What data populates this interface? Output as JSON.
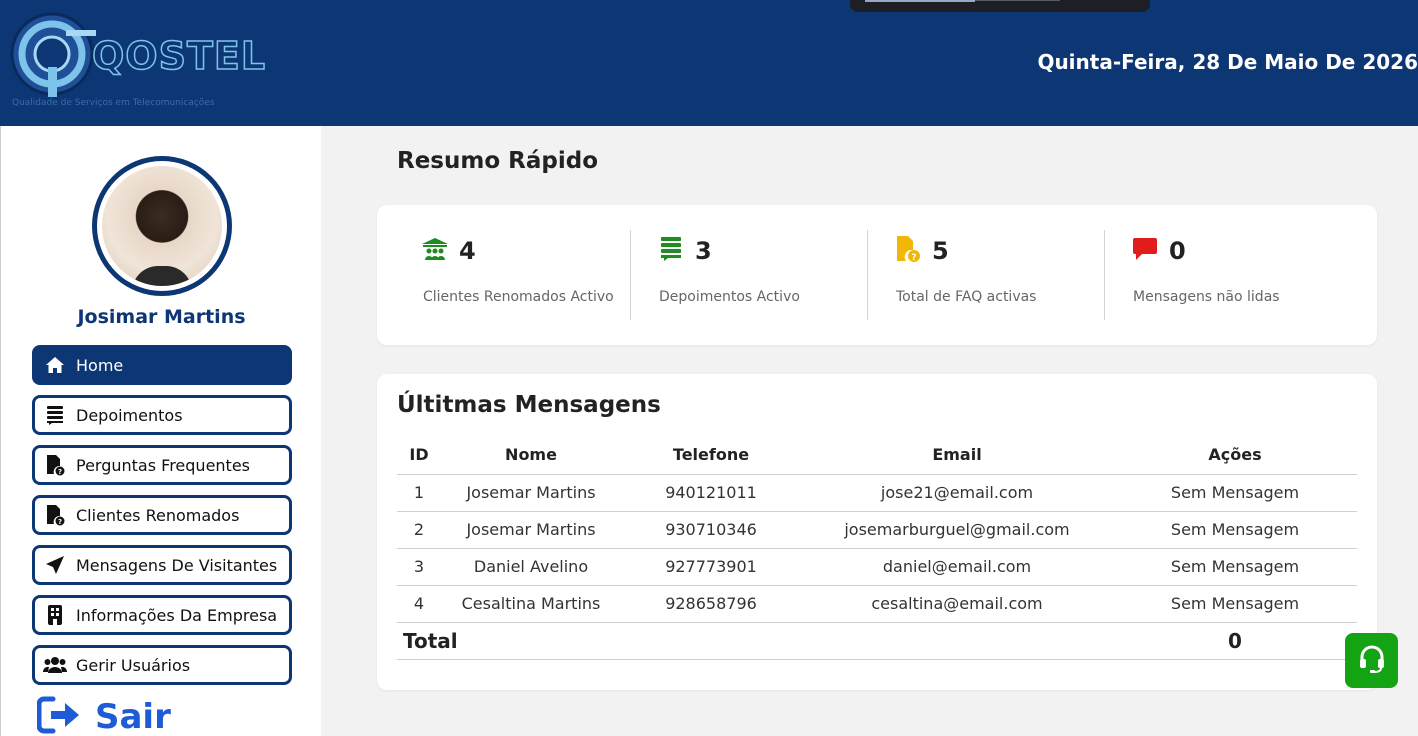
{
  "header": {
    "logo_text": "QOSTEL",
    "logo_subtitle": "Qualidade de Serviços em Telecomunicações",
    "date": "Quinta-Feira, 28 De Maio De 2026"
  },
  "sidebar": {
    "user_name": "Josimar Martins",
    "items": [
      {
        "label": "Home",
        "icon": "home-icon",
        "active": true
      },
      {
        "label": "Depoimentos",
        "icon": "list-icon"
      },
      {
        "label": "Perguntas Frequentes",
        "icon": "file-question-icon"
      },
      {
        "label": "Clientes Renomados",
        "icon": "file-question-icon"
      },
      {
        "label": "Mensagens De Visitantes",
        "icon": "send-icon"
      },
      {
        "label": "Informações Da Empresa",
        "icon": "building-icon"
      },
      {
        "label": "Gerir Usuários",
        "icon": "users-icon"
      }
    ],
    "logout_label": "Sair"
  },
  "summary": {
    "title": "Resumo Rápido",
    "stats": [
      {
        "value": "4",
        "label": "Clientes Renomados Activo",
        "icon": "people-building-icon",
        "color": "#1e8c1e"
      },
      {
        "value": "3",
        "label": "Depoimentos Activo",
        "icon": "list-icon",
        "color": "#1e8c1e"
      },
      {
        "value": "5",
        "label": "Total de FAQ activas",
        "icon": "file-question-icon",
        "color": "#f2b705"
      },
      {
        "value": "0",
        "label": "Mensagens não lidas",
        "icon": "chat-icon",
        "color": "#e21b1b"
      }
    ]
  },
  "messages": {
    "title": "Últitmas Mensagens",
    "columns": [
      "ID",
      "Nome",
      "Telefone",
      "Email",
      "Ações"
    ],
    "rows": [
      {
        "id": "1",
        "name": "Josemar Martins",
        "phone": "940121011",
        "email": "jose21@email.com",
        "action": "Sem Mensagem"
      },
      {
        "id": "2",
        "name": "Josemar Martins",
        "phone": "930710346",
        "email": "josemarburguel@gmail.com",
        "action": "Sem Mensagem"
      },
      {
        "id": "3",
        "name": "Daniel Avelino",
        "phone": "927773901",
        "email": "daniel@email.com",
        "action": "Sem Mensagem"
      },
      {
        "id": "4",
        "name": "Cesaltina Martins",
        "phone": "928658796",
        "email": "cesaltina@email.com",
        "action": "Sem Mensagem"
      }
    ],
    "total_label": "Total",
    "total_value": "0"
  },
  "help_button": {
    "icon": "headset-icon",
    "color": "#13a313"
  },
  "colors": {
    "primary": "#0d3675",
    "accent": "#1e5bd6"
  }
}
